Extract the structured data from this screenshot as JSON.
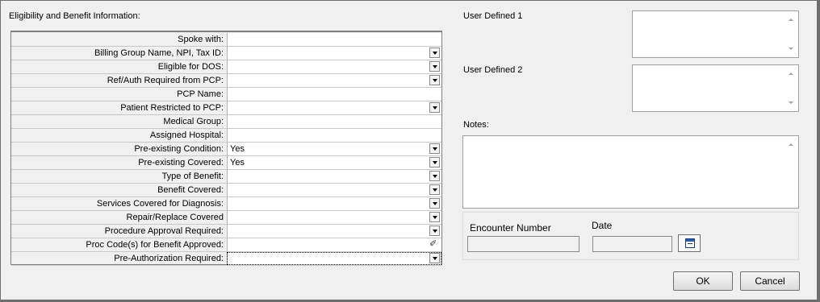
{
  "form": {
    "section_title": "Eligibility and Benefit Information:",
    "fields": [
      {
        "label": "Spoke with:",
        "value": "",
        "control": "text"
      },
      {
        "label": "Billing Group Name, NPI, Tax ID:",
        "value": "",
        "control": "dropdown"
      },
      {
        "label": "Eligible for DOS:",
        "value": "",
        "control": "dropdown"
      },
      {
        "label": "Ref/Auth Required from PCP:",
        "value": "",
        "control": "dropdown"
      },
      {
        "label": "PCP Name:",
        "value": "",
        "control": "text"
      },
      {
        "label": "Patient Restricted to PCP:",
        "value": "",
        "control": "dropdown"
      },
      {
        "label": "Medical Group:",
        "value": "",
        "control": "text"
      },
      {
        "label": "Assigned Hospital:",
        "value": "",
        "control": "text"
      },
      {
        "label": "Pre-existing Condition:",
        "value": "Yes",
        "control": "dropdown"
      },
      {
        "label": "Pre-existing Covered:",
        "value": "Yes",
        "control": "dropdown"
      },
      {
        "label": "Type of Benefit:",
        "value": "",
        "control": "dropdown"
      },
      {
        "label": "Benefit Covered:",
        "value": "",
        "control": "dropdown"
      },
      {
        "label": "Services Covered for Diagnosis:",
        "value": "",
        "control": "dropdown"
      },
      {
        "label": "Repair/Replace Covered",
        "value": "",
        "control": "dropdown"
      },
      {
        "label": "Procedure Approval Required:",
        "value": "",
        "control": "dropdown"
      },
      {
        "label": "Proc Code(s) for Benefit Approved:",
        "value": "",
        "control": "picker"
      },
      {
        "label": "Pre-Authorization Required:",
        "value": "",
        "control": "dropdown"
      }
    ]
  },
  "right": {
    "user_defined_1_label": "User Defined 1",
    "user_defined_1_value": "",
    "user_defined_2_label": "User Defined 2",
    "user_defined_2_value": "",
    "notes_label": "Notes:",
    "notes_value": "",
    "encounter_label": "Encounter Number",
    "encounter_value": "",
    "date_label": "Date",
    "date_value": ""
  },
  "buttons": {
    "ok": "OK",
    "cancel": "Cancel"
  },
  "icons": {
    "dropdown": "chevron-down-icon",
    "picker": "eyedropper-icon",
    "calendar": "calendar-icon"
  }
}
